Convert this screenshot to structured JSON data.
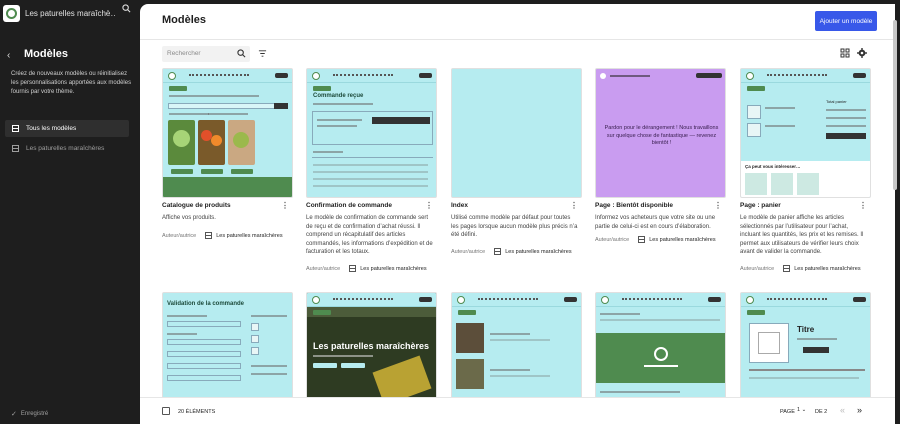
{
  "site": {
    "name": "Les paturelles maraîchè…"
  },
  "sidebar": {
    "title": "Modèles",
    "description": "Créez de nouveaux modèles ou réinitialisez les personnalisations apportées aux modèles fournis par votre thème.",
    "items": [
      {
        "label": "Tous les modèles",
        "active": true
      },
      {
        "label": "Les paturelles maraîchères",
        "active": false
      }
    ],
    "saved_label": "Enregistré"
  },
  "header": {
    "title": "Modèles",
    "add_button": "Ajouter un modèle",
    "search_placeholder": "Rechercher"
  },
  "cards": [
    {
      "title": "Catalogue de produits",
      "description": "Affiche vos produits.",
      "author": "Auteur/autrice",
      "owner": "Les paturelles maraîchères"
    },
    {
      "title": "Confirmation de commande",
      "description": "Le modèle de confirmation de commande sert de reçu et de confirmation d’achat réussi. Il comprend un récapitulatif des articles commandés, les informations d’expédition et de facturation et les totaux.",
      "author": "Auteur/autrice",
      "owner": "Les paturelles maraîchères"
    },
    {
      "title": "Index",
      "description": "Utilisé comme modèle par défaut pour toutes les pages lorsque aucun modèle plus précis n’a été défini.",
      "author": "Auteur/autrice",
      "owner": "Les paturelles maraîchères"
    },
    {
      "title": "Page : Bientôt disponible",
      "description": "Informez vos acheteurs que votre site ou une partie de celui-ci est en cours d’élaboration.",
      "author": "Auteur/autrice",
      "owner": "Les paturelles maraîchères"
    },
    {
      "title": "Page : panier",
      "description": "Le modèle de panier affiche les articles sélectionnés par l’utilisateur pour l’achat, incluant les quantités, les prix et les remises. Il permet aux utilisateurs de vérifier leurs choix avant de valider la commande.",
      "author": "Auteur/autrice",
      "owner": "Les paturelles maraîchères"
    }
  ],
  "thumbs": {
    "order_title": "Commande reçue",
    "coming_soon": "Pardon pour le dérangement ! Nous travaillons sur quelque chose de fantastique — revenez bientôt !",
    "cart_more": "Ça peut vous intéresser…",
    "checkout_title": "Validation de la commande",
    "hero_title": "Les paturelles maraîchères",
    "cart_total": "Total panier",
    "product_title": "Titre"
  },
  "footer": {
    "count": "20 ÉLÉMENTS",
    "page_label": "PAGE",
    "page_value": "1",
    "of_label": "DE 2",
    "first": "«",
    "last": "»"
  },
  "colors": {
    "accent": "#3858e9",
    "thumb_bg": "#b6ecf0",
    "brand_green": "#4f8b4f",
    "coming_soon_bg": "#c99cf0"
  }
}
